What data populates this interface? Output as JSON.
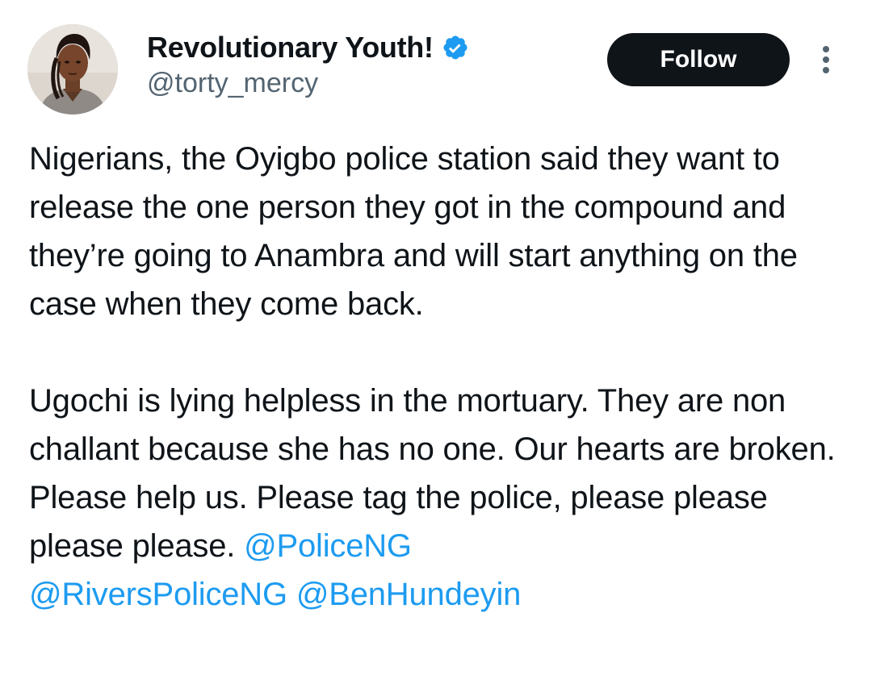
{
  "author": {
    "display_name": "Revolutionary Youth!",
    "handle": "@torty_mercy",
    "verified": true
  },
  "actions": {
    "follow_label": "Follow"
  },
  "tweet": {
    "paragraph_1": "Nigerians, the Oyigbo police station said they want to release the one person they got in the compound and they’re going to Anambra and will start anything on the case when they come back.",
    "paragraph_2_text": "Ugochi is lying helpless in the mortuary. They are non challant because she has no one. Our hearts are broken. Please help us. Please tag the police, please please please please. ",
    "mentions": [
      "@PoliceNG",
      "@RiversPoliceNG",
      "@BenHundeyin"
    ]
  },
  "icons": {
    "verified": "verified-badge-icon",
    "more": "more-options-icon"
  },
  "colors": {
    "text": "#0f1419",
    "secondary_text": "#536471",
    "link": "#1d9bf0",
    "follow_bg": "#0f1419",
    "verified": "#1d9bf0"
  }
}
